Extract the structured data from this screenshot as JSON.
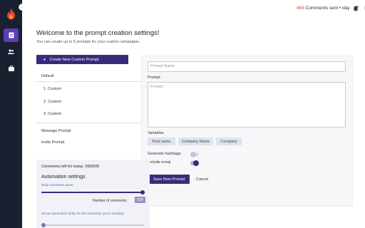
{
  "header": {
    "comments_count": "463",
    "comments_label": "Comments sent • day"
  },
  "page": {
    "title": "Welcome to the prompt creation settings!",
    "subtitle": "You can create up to 5 prompts for your custom campaigns."
  },
  "create_button": {
    "plus": "+",
    "label": "Create New  Custom Prompt"
  },
  "prompts": {
    "default": "Default",
    "customs": [
      "1. Custom",
      "2. Custom",
      "3. Custom"
    ],
    "message": "Message Prompt",
    "invite": "Invite Prompt"
  },
  "form": {
    "prompt_name_placeholder": "Prompt Name",
    "prompt_label": "Prompt",
    "prompt_placeholder": "Prompt",
    "variables_label": "Variables",
    "variables": [
      "First name",
      "Company Name",
      "Company"
    ],
    "hashtags_label": "Generate hashtags",
    "hashtags_on": false,
    "emoji_label": "Include emoji",
    "emoji_on": true,
    "save_label": "Save New Prompt",
    "cancel_label": "Cancel"
  },
  "comments_panel": {
    "left_text": "Comments left  for today:  500/500",
    "automation_title": "Automation settings",
    "daily_quota_label": "Daily comments quota",
    "quota_fill": 1.0,
    "number_label": "Number of comments",
    "number_value": "500",
    "delay_text": "Set an automation delay for the comments you're sending.",
    "delay_fill": 0.0
  },
  "colors": {
    "accent": "#3b2a7a",
    "rail": "#1b2030",
    "active_nav": "#5a3fb4",
    "counter": "#d0432e"
  }
}
